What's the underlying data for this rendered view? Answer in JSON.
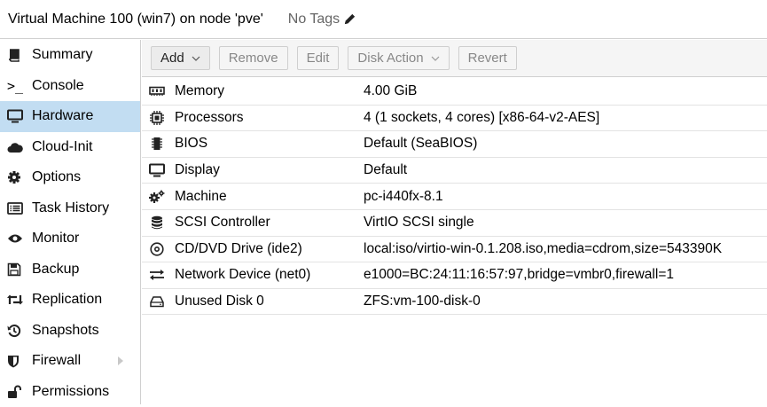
{
  "header": {
    "title": "Virtual Machine 100 (win7) on node 'pve'",
    "tags_label": "No Tags"
  },
  "sidebar": {
    "items": [
      {
        "label": "Summary",
        "icon": "book-icon"
      },
      {
        "label": "Console",
        "icon": "terminal-icon"
      },
      {
        "label": "Hardware",
        "icon": "desktop-icon",
        "active": true
      },
      {
        "label": "Cloud-Init",
        "icon": "cloud-icon"
      },
      {
        "label": "Options",
        "icon": "gear-icon"
      },
      {
        "label": "Task History",
        "icon": "list-icon"
      },
      {
        "label": "Monitor",
        "icon": "eye-icon"
      },
      {
        "label": "Backup",
        "icon": "floppy-icon"
      },
      {
        "label": "Replication",
        "icon": "retweet-icon"
      },
      {
        "label": "Snapshots",
        "icon": "history-icon"
      },
      {
        "label": "Firewall",
        "icon": "shield-icon"
      },
      {
        "label": "Permissions",
        "icon": "unlock-icon"
      }
    ]
  },
  "toolbar": {
    "add_label": "Add",
    "remove_label": "Remove",
    "edit_label": "Edit",
    "disk_action_label": "Disk Action",
    "revert_label": "Revert"
  },
  "hardware": {
    "rows": [
      {
        "name": "Memory",
        "value": "4.00 GiB",
        "icon": "memory-icon"
      },
      {
        "name": "Processors",
        "value": "4 (1 sockets, 4 cores) [x86-64-v2-AES]",
        "icon": "cpu-icon"
      },
      {
        "name": "BIOS",
        "value": "Default (SeaBIOS)",
        "icon": "microchip-icon"
      },
      {
        "name": "Display",
        "value": "Default",
        "icon": "desktop-icon"
      },
      {
        "name": "Machine",
        "value": "pc-i440fx-8.1",
        "icon": "cogs-icon"
      },
      {
        "name": "SCSI Controller",
        "value": "VirtIO SCSI single",
        "icon": "database-icon"
      },
      {
        "name": "CD/DVD Drive (ide2)",
        "value": "local:iso/virtio-win-0.1.208.iso,media=cdrom,size=543390K",
        "icon": "disc-icon"
      },
      {
        "name": "Network Device (net0)",
        "value": "e1000=BC:24:11:16:57:97,bridge=vmbr0,firewall=1",
        "icon": "exchange-icon"
      },
      {
        "name": "Unused Disk 0",
        "value": "ZFS:vm-100-disk-0",
        "icon": "hdd-icon"
      }
    ]
  }
}
